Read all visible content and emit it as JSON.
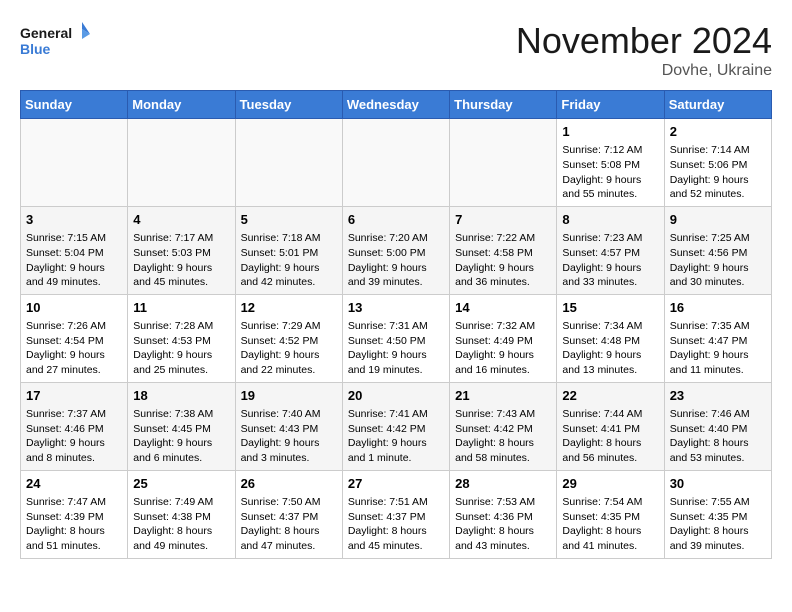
{
  "header": {
    "logo_line1": "General",
    "logo_line2": "Blue",
    "month_title": "November 2024",
    "location": "Dovhe, Ukraine"
  },
  "days_of_week": [
    "Sunday",
    "Monday",
    "Tuesday",
    "Wednesday",
    "Thursday",
    "Friday",
    "Saturday"
  ],
  "weeks": [
    [
      {
        "day": "",
        "info": ""
      },
      {
        "day": "",
        "info": ""
      },
      {
        "day": "",
        "info": ""
      },
      {
        "day": "",
        "info": ""
      },
      {
        "day": "",
        "info": ""
      },
      {
        "day": "1",
        "info": "Sunrise: 7:12 AM\nSunset: 5:08 PM\nDaylight: 9 hours and 55 minutes."
      },
      {
        "day": "2",
        "info": "Sunrise: 7:14 AM\nSunset: 5:06 PM\nDaylight: 9 hours and 52 minutes."
      }
    ],
    [
      {
        "day": "3",
        "info": "Sunrise: 7:15 AM\nSunset: 5:04 PM\nDaylight: 9 hours and 49 minutes."
      },
      {
        "day": "4",
        "info": "Sunrise: 7:17 AM\nSunset: 5:03 PM\nDaylight: 9 hours and 45 minutes."
      },
      {
        "day": "5",
        "info": "Sunrise: 7:18 AM\nSunset: 5:01 PM\nDaylight: 9 hours and 42 minutes."
      },
      {
        "day": "6",
        "info": "Sunrise: 7:20 AM\nSunset: 5:00 PM\nDaylight: 9 hours and 39 minutes."
      },
      {
        "day": "7",
        "info": "Sunrise: 7:22 AM\nSunset: 4:58 PM\nDaylight: 9 hours and 36 minutes."
      },
      {
        "day": "8",
        "info": "Sunrise: 7:23 AM\nSunset: 4:57 PM\nDaylight: 9 hours and 33 minutes."
      },
      {
        "day": "9",
        "info": "Sunrise: 7:25 AM\nSunset: 4:56 PM\nDaylight: 9 hours and 30 minutes."
      }
    ],
    [
      {
        "day": "10",
        "info": "Sunrise: 7:26 AM\nSunset: 4:54 PM\nDaylight: 9 hours and 27 minutes."
      },
      {
        "day": "11",
        "info": "Sunrise: 7:28 AM\nSunset: 4:53 PM\nDaylight: 9 hours and 25 minutes."
      },
      {
        "day": "12",
        "info": "Sunrise: 7:29 AM\nSunset: 4:52 PM\nDaylight: 9 hours and 22 minutes."
      },
      {
        "day": "13",
        "info": "Sunrise: 7:31 AM\nSunset: 4:50 PM\nDaylight: 9 hours and 19 minutes."
      },
      {
        "day": "14",
        "info": "Sunrise: 7:32 AM\nSunset: 4:49 PM\nDaylight: 9 hours and 16 minutes."
      },
      {
        "day": "15",
        "info": "Sunrise: 7:34 AM\nSunset: 4:48 PM\nDaylight: 9 hours and 13 minutes."
      },
      {
        "day": "16",
        "info": "Sunrise: 7:35 AM\nSunset: 4:47 PM\nDaylight: 9 hours and 11 minutes."
      }
    ],
    [
      {
        "day": "17",
        "info": "Sunrise: 7:37 AM\nSunset: 4:46 PM\nDaylight: 9 hours and 8 minutes."
      },
      {
        "day": "18",
        "info": "Sunrise: 7:38 AM\nSunset: 4:45 PM\nDaylight: 9 hours and 6 minutes."
      },
      {
        "day": "19",
        "info": "Sunrise: 7:40 AM\nSunset: 4:43 PM\nDaylight: 9 hours and 3 minutes."
      },
      {
        "day": "20",
        "info": "Sunrise: 7:41 AM\nSunset: 4:42 PM\nDaylight: 9 hours and 1 minute."
      },
      {
        "day": "21",
        "info": "Sunrise: 7:43 AM\nSunset: 4:42 PM\nDaylight: 8 hours and 58 minutes."
      },
      {
        "day": "22",
        "info": "Sunrise: 7:44 AM\nSunset: 4:41 PM\nDaylight: 8 hours and 56 minutes."
      },
      {
        "day": "23",
        "info": "Sunrise: 7:46 AM\nSunset: 4:40 PM\nDaylight: 8 hours and 53 minutes."
      }
    ],
    [
      {
        "day": "24",
        "info": "Sunrise: 7:47 AM\nSunset: 4:39 PM\nDaylight: 8 hours and 51 minutes."
      },
      {
        "day": "25",
        "info": "Sunrise: 7:49 AM\nSunset: 4:38 PM\nDaylight: 8 hours and 49 minutes."
      },
      {
        "day": "26",
        "info": "Sunrise: 7:50 AM\nSunset: 4:37 PM\nDaylight: 8 hours and 47 minutes."
      },
      {
        "day": "27",
        "info": "Sunrise: 7:51 AM\nSunset: 4:37 PM\nDaylight: 8 hours and 45 minutes."
      },
      {
        "day": "28",
        "info": "Sunrise: 7:53 AM\nSunset: 4:36 PM\nDaylight: 8 hours and 43 minutes."
      },
      {
        "day": "29",
        "info": "Sunrise: 7:54 AM\nSunset: 4:35 PM\nDaylight: 8 hours and 41 minutes."
      },
      {
        "day": "30",
        "info": "Sunrise: 7:55 AM\nSunset: 4:35 PM\nDaylight: 8 hours and 39 minutes."
      }
    ]
  ]
}
